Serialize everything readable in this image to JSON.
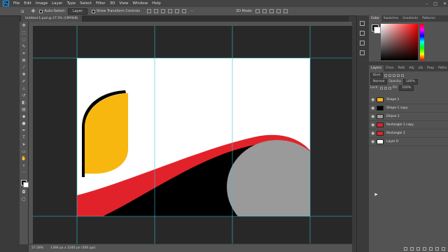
{
  "app": {
    "name": "Photoshop"
  },
  "menu": [
    "File",
    "Edit",
    "Image",
    "Layer",
    "Type",
    "Select",
    "Filter",
    "3D",
    "View",
    "Window",
    "Help"
  ],
  "options_bar": {
    "auto_select_label": "Auto-Select:",
    "auto_select_value": "Layer",
    "transform_controls_label": "Show Transform Controls",
    "mode_3d_label": "3D Mode:"
  },
  "document": {
    "tab_title": "Untitled-1.psd @ 27.5% (CMYK/8)"
  },
  "status_bar": {
    "zoom": "27.58%",
    "doc_size": "1366 px x 2240 px (300 ppi)"
  },
  "color_panel": {
    "tabs": [
      "Color",
      "Swatches",
      "Gradients",
      "Patterns"
    ],
    "active_tab": "Color",
    "foreground_color": "#000000",
    "background_color": "#ffffff"
  },
  "layers_panel": {
    "tabs": [
      "Layers",
      "Chan",
      "Path",
      "Adj",
      "Lib",
      "Prop",
      "Paths"
    ],
    "active_tab": "Layers",
    "filter_label": "Kind",
    "blend_mode": "Normal",
    "opacity_label": "Opacity:",
    "opacity_value": "100%",
    "lock_label": "Lock:",
    "fill_label": "Fill:",
    "fill_value": "100%",
    "layers": [
      {
        "name": "Shape 1",
        "thumb_color": "#f7b70f"
      },
      {
        "name": "Shape 1 copy",
        "thumb_color": "#000000"
      },
      {
        "name": "Ellipse 1",
        "thumb_color": "#9a9a9a"
      },
      {
        "name": "Rectangle 1 copy",
        "thumb_color": "#e2222a"
      },
      {
        "name": "Rectangle 1",
        "thumb_color": "#e2222a"
      },
      {
        "name": "Layer 0",
        "thumb_color": "#ffffff"
      }
    ]
  },
  "artwork_colors": {
    "yellow": "#f7b70f",
    "red": "#e2222a",
    "black": "#000000",
    "gray": "#9a9a9a",
    "guide": "#38c3d6"
  }
}
